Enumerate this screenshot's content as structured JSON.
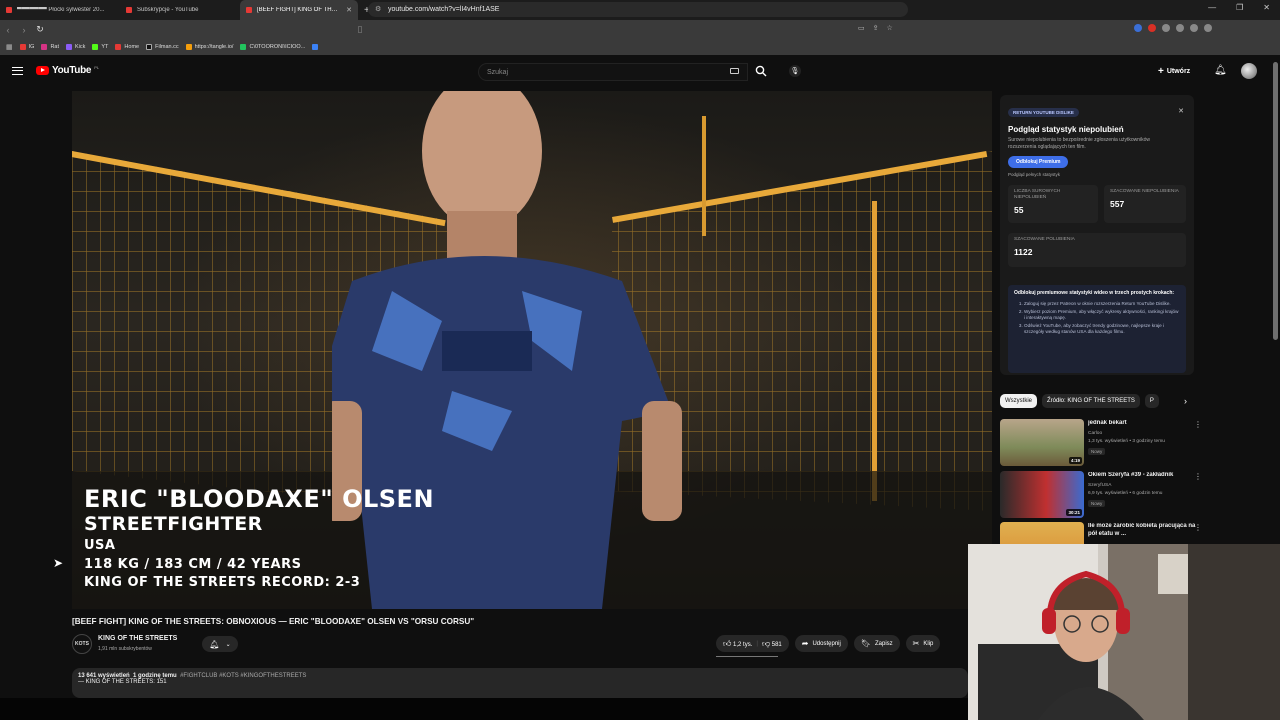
{
  "browser": {
    "tabs": [
      {
        "label": "▀▀▀▀▀▀▀ Płocki sylwester 20..."
      },
      {
        "label": "Subskrypcje - YouTube"
      },
      {
        "label": "[BEEF FIGHT] KING OF THE ST..."
      }
    ],
    "url": "youtube.com/watch?v=lI4vHnf1ASE",
    "bookmarks": [
      "IG",
      "Rat",
      "Kick",
      "YT",
      "Home",
      "Filman.cc",
      "https://tangle.io/",
      "C\\0TOORONI\\ICIOO..."
    ]
  },
  "header": {
    "logo": "YouTube",
    "logo_country": "PL",
    "search_placeholder": "Szukaj",
    "create_label": "Utwórz"
  },
  "video": {
    "overlay": {
      "name": "ERIC \"BLOODAXE\" OLSEN",
      "style": "STREETFIGHTER",
      "country": "USA",
      "stats": "118 KG /  183 CM / 42 YEARS",
      "record": "KING OF THE STREETS RECORD: 2-3"
    },
    "title": "[BEEF FIGHT] KING OF THE STREETS: OBNOXIOUS — ERIC \"BLOODAXE\" OLSEN VS \"ORSU CORSU\"",
    "channel": {
      "name": "KING OF THE STREETS",
      "subs": "1,91 mln subskrybentów",
      "avatar_text": "KOTS"
    },
    "actions": {
      "likes": "1,2 tys.",
      "dislikes": "581",
      "share": "Udostępnij",
      "save": "Zapisz",
      "clip": "Klip"
    },
    "description": {
      "views": "13 641 wyświetleń",
      "time": "1 godzinę temu",
      "tags": "#FIGHTCLUB #KOTS #KINGOFTHESTREETS",
      "line2": "— KING OF THE STREETS: 151"
    }
  },
  "ryd": {
    "badge": "RETURN YOUTUBE DISLIKE",
    "title": "Podgląd statystyk niepolubień",
    "subtitle": "Surowe niepolubienia to bezpośrednie zgłoszenia użytkowników rozszerzenia oglądających ten film.",
    "button": "Odblokuj Premium",
    "link": "Podgląd pełnych statystyk",
    "raw_label": "LICZBA SUROWYCH NIEPOLUBIEŃ",
    "raw_value": "55",
    "est_dis_label": "SZACOWANE NIEPOLUBIENIA",
    "est_dis_value": "557",
    "est_likes_label": "SZACOWANE POLUBIENIA",
    "est_likes_value": "1122",
    "info_head": "Odblokuj premiumowe statystyki wideo w trzech prostych krokach:",
    "steps": [
      "Zaloguj się przez Patreon w oknie rozszerzenia Return YouTube Dislike.",
      "Wybierz poziom Premium, aby włączyć wykresy aktywności, rankingi krajów i interaktywną mapę.",
      "Odśwież YouTube, aby zobaczyć trendy godzinowe, najlepsze kraje i szczegóły według stanów USA dla każdego filmu."
    ]
  },
  "chips": [
    "Wszystkie",
    "Źródło: KING OF THE STREETS",
    "P"
  ],
  "recommended": [
    {
      "title": "jednak bekart",
      "channel": "Carloo",
      "meta": "1,3 tys. wyświetleń • 3 godziny temu",
      "badge": "Nowy",
      "duration": "4:19"
    },
    {
      "title": "Okiem Szeryfa #39 - zakładnik",
      "channel": "SzeryfUSA",
      "meta": "6,9 tys. wyświetleń • 6 godzin temu",
      "badge": "Nowy",
      "duration": "30:21"
    },
    {
      "title": "Ile może zarobić kobieta pracująca na pół etatu w ...",
      "channel": "",
      "meta": "",
      "badge": "",
      "duration": ""
    }
  ]
}
